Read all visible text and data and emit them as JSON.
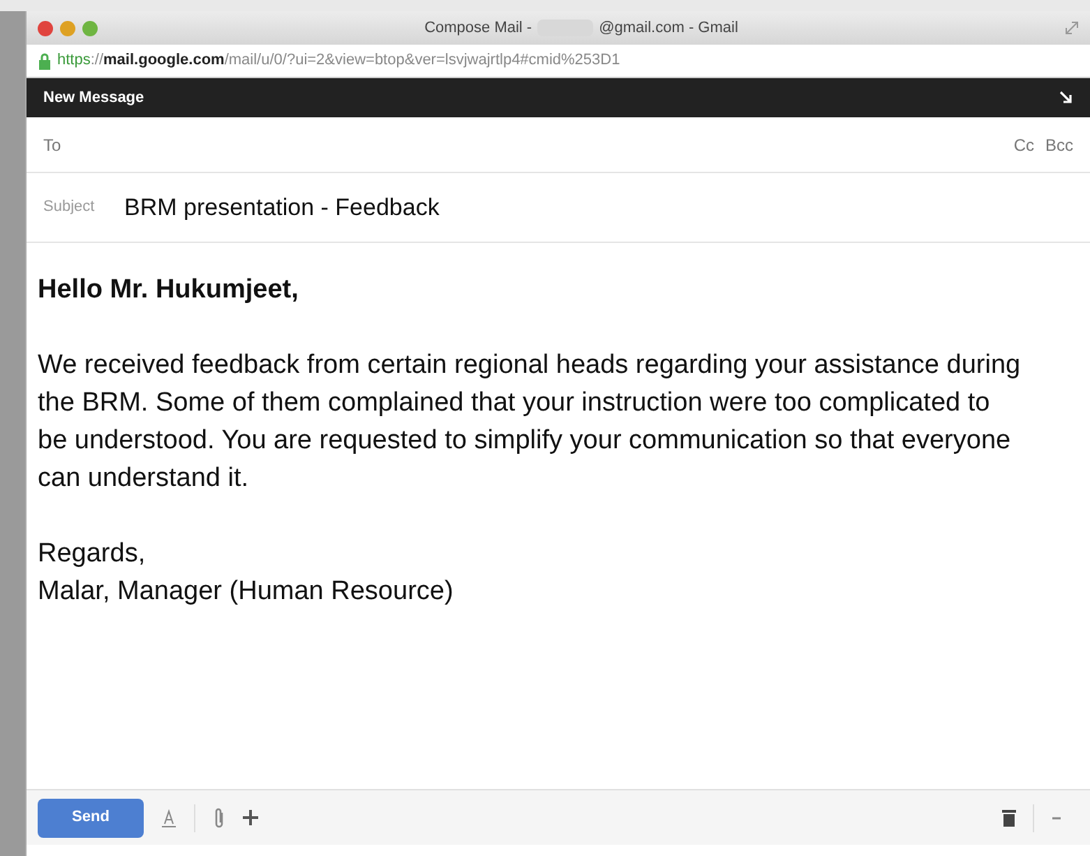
{
  "window": {
    "title_parts": [
      "Compose Mail -",
      "@gmail.com - Gmail"
    ]
  },
  "address_bar": {
    "scheme": "https",
    "host": "://mail.google.com",
    "path": "/mail/u/0/?ui=2&view=btop&ver=lsvjwajrtlp4#cmid%253D1"
  },
  "compose": {
    "header": "New Message",
    "to_label": "To",
    "cc": "Cc",
    "bcc": "Bcc",
    "subject_label": "Subject",
    "subject": "BRM presentation - Feedback",
    "body": [
      {
        "kind": "greeting",
        "text": "Hello Mr. Hukumjeet,"
      },
      {
        "kind": "paragraph",
        "text": "We received feedback from certain regional heads regarding your assistance during the BRM. Some of them complained that your instruction were too complicated to be understood. You are requested to simplify your communication so that everyone can understand it."
      },
      {
        "kind": "line",
        "text": "Regards,"
      },
      {
        "kind": "line",
        "text": "Malar, Manager (Human Resource)"
      }
    ],
    "send": "Send"
  }
}
